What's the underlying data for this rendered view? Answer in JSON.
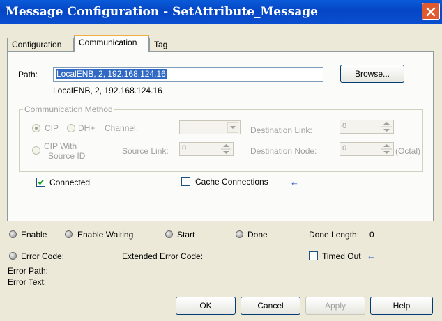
{
  "window": {
    "title": "Message Configuration - SetAttribute_Message"
  },
  "tabs": [
    {
      "label": "Configuration",
      "active": false
    },
    {
      "label": "Communication",
      "active": true
    },
    {
      "label": "Tag",
      "active": false
    }
  ],
  "path": {
    "label": "Path:",
    "value": "LocalENB, 2, 192.168.124.16",
    "resolved": "LocalENB, 2, 192.168.124.16",
    "browse_label": "Browse..."
  },
  "comm_method": {
    "group_label": "Communication Method",
    "cip_label": "CIP",
    "dhplus_label": "DH+",
    "channel_label": "Channel:",
    "channel_value": "",
    "dest_link_label": "Destination Link:",
    "dest_link_value": "0",
    "cip_source_id_label_1": "CIP With",
    "cip_source_id_label_2": "Source ID",
    "source_link_label": "Source Link:",
    "source_link_value": "0",
    "dest_node_label": "Destination Node:",
    "dest_node_value": "0",
    "octal_label": "(Octal)",
    "selected": "CIP"
  },
  "options": {
    "connected_label": "Connected",
    "connected_checked": true,
    "cache_label": "Cache Connections",
    "cache_checked": false
  },
  "status": {
    "enable": "Enable",
    "enable_waiting": "Enable Waiting",
    "start": "Start",
    "done": "Done",
    "done_length_label": "Done Length:",
    "done_length_value": "0",
    "error_code_label": "Error Code:",
    "extended_error_label": "Extended Error Code:",
    "timed_out_label": "Timed Out",
    "timed_out_checked": false,
    "error_path_label": "Error Path:",
    "error_text_label": "Error Text:"
  },
  "buttons": {
    "ok": "OK",
    "cancel": "Cancel",
    "apply": "Apply",
    "help": "Help"
  },
  "colors": {
    "titlebar": "#0446c4",
    "dialog_bg": "#ece9d8",
    "selection": "#316ac5",
    "arrow": "#1a4fc0"
  }
}
